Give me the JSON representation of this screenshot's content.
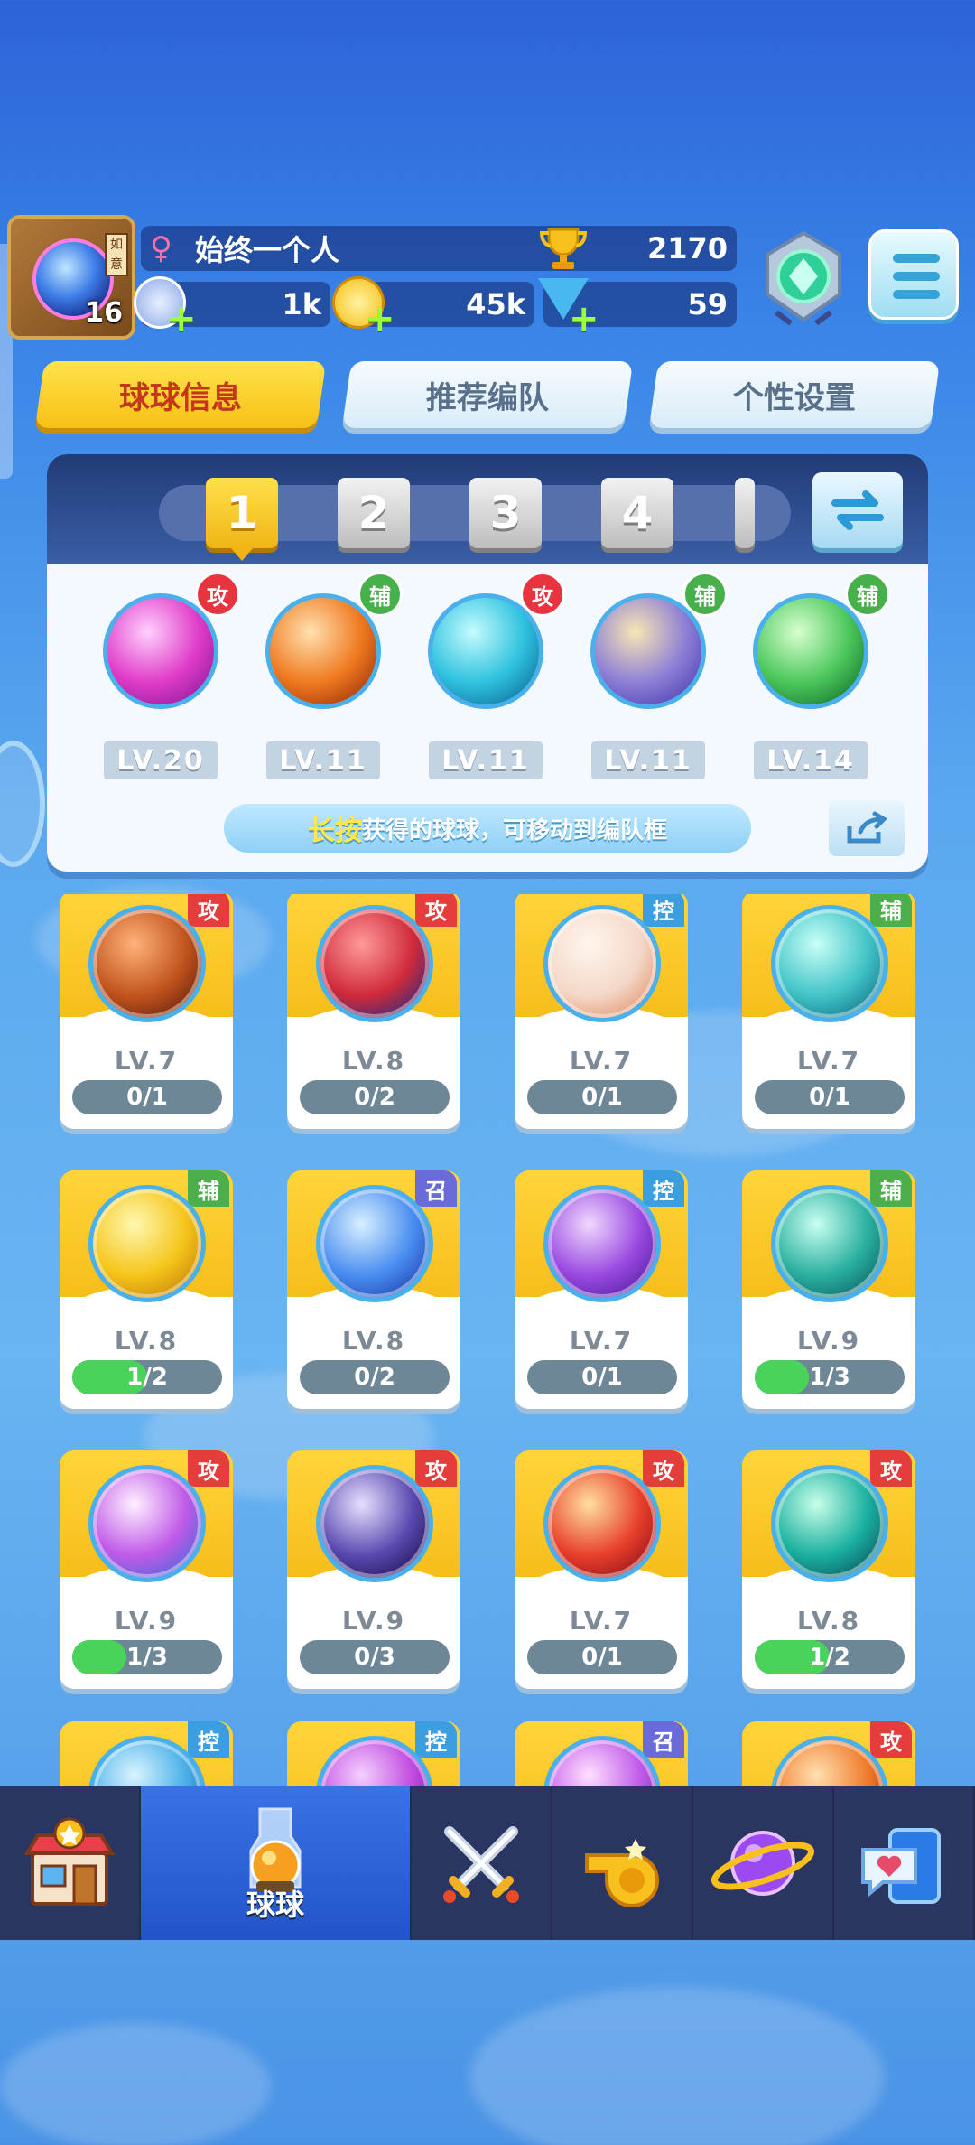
{
  "player": {
    "avatar_level": "16",
    "name": "始终一个人",
    "trophies": "2170",
    "energy": "1k",
    "coins": "45k",
    "gems": "59"
  },
  "tabs": [
    {
      "label": "球球信息",
      "active": true
    },
    {
      "label": "推荐编队",
      "active": false
    },
    {
      "label": "个性设置",
      "active": false
    }
  ],
  "team_slots": [
    "1",
    "2",
    "3",
    "4"
  ],
  "team": [
    {
      "type": "攻",
      "type_class": "atk",
      "level": "LV.20",
      "colors": [
        "#ffd0ff",
        "#e03cc8",
        "#8a1a9a"
      ]
    },
    {
      "type": "辅",
      "type_class": "sup",
      "level": "LV.11",
      "colors": [
        "#ffe1b0",
        "#f07a20",
        "#9a2e0a"
      ]
    },
    {
      "type": "攻",
      "type_class": "atk",
      "level": "LV.11",
      "colors": [
        "#c6fbff",
        "#2fc3de",
        "#0c6a9a"
      ]
    },
    {
      "type": "辅",
      "type_class": "sup",
      "level": "LV.11",
      "colors": [
        "#f9e6b4",
        "#8d7fd6",
        "#4b3db0"
      ]
    },
    {
      "type": "辅",
      "type_class": "sup",
      "level": "LV.14",
      "colors": [
        "#d8ffd0",
        "#4cc85c",
        "#136e2b"
      ]
    }
  ],
  "hint": {
    "highlight": "长按",
    "text": "获得的球球，可移动到编队框"
  },
  "balls": [
    {
      "type": "攻",
      "type_class": "atk",
      "level": "LV.7",
      "progress": "0/1",
      "fraction": 0,
      "colors": [
        "#ffb27a",
        "#c2541e",
        "#5a1a08"
      ]
    },
    {
      "type": "攻",
      "type_class": "atk",
      "level": "LV.8",
      "progress": "0/2",
      "fraction": 0,
      "colors": [
        "#ff9a9a",
        "#d02a3a",
        "#1a2a8a"
      ]
    },
    {
      "type": "控",
      "type_class": "ctl",
      "level": "LV.7",
      "progress": "0/1",
      "fraction": 0,
      "colors": [
        "#fff6ee",
        "#f4d8c8",
        "#e08a60"
      ]
    },
    {
      "type": "辅",
      "type_class": "sup",
      "level": "LV.7",
      "progress": "0/1",
      "fraction": 0,
      "colors": [
        "#c8fff6",
        "#42c4c8",
        "#0c6a80"
      ]
    },
    {
      "type": "辅",
      "type_class": "sup",
      "level": "LV.8",
      "progress": "1/2",
      "fraction": 0.5,
      "colors": [
        "#fff8b0",
        "#f5c51a",
        "#c07a08"
      ]
    },
    {
      "type": "召",
      "type_class": "sum",
      "level": "LV.8",
      "progress": "0/2",
      "fraction": 0,
      "colors": [
        "#d8f0ff",
        "#4a8ef0",
        "#1a3aa8"
      ]
    },
    {
      "type": "控",
      "type_class": "ctl",
      "level": "LV.7",
      "progress": "0/1",
      "fraction": 0,
      "colors": [
        "#f0d8ff",
        "#9a4ae0",
        "#4a1a9a"
      ]
    },
    {
      "type": "辅",
      "type_class": "sup",
      "level": "LV.9",
      "progress": "1/3",
      "fraction": 0.333,
      "colors": [
        "#c8fff0",
        "#2ab0a0",
        "#0a5a60"
      ]
    },
    {
      "type": "攻",
      "type_class": "atk",
      "level": "LV.9",
      "progress": "1/3",
      "fraction": 0.333,
      "colors": [
        "#fff0ff",
        "#c05ae8",
        "#3a6ad8"
      ]
    },
    {
      "type": "攻",
      "type_class": "atk",
      "level": "LV.9",
      "progress": "0/3",
      "fraction": 0,
      "colors": [
        "#e8e0ff",
        "#5a4ab0",
        "#1a0a4a"
      ]
    },
    {
      "type": "攻",
      "type_class": "atk",
      "level": "LV.7",
      "progress": "0/1",
      "fraction": 0,
      "colors": [
        "#ffe0a0",
        "#e8402a",
        "#8a0a1a"
      ]
    },
    {
      "type": "攻",
      "type_class": "atk",
      "level": "LV.8",
      "progress": "1/2",
      "fraction": 0.5,
      "colors": [
        "#c8ffe8",
        "#1ab0a0",
        "#0a4a5a"
      ]
    },
    {
      "type": "控",
      "type_class": "ctl",
      "level": "",
      "progress": "",
      "fraction": 0,
      "colors": [
        "#d8f4ff",
        "#4ab0e8",
        "#1a5aa8"
      ]
    },
    {
      "type": "控",
      "type_class": "ctl",
      "level": "",
      "progress": "",
      "fraction": 0,
      "colors": [
        "#f4d0ff",
        "#c04ae0",
        "#5a1a9a"
      ]
    },
    {
      "type": "召",
      "type_class": "sum",
      "level": "",
      "progress": "",
      "fraction": 0,
      "colors": [
        "#ffe0ff",
        "#c05ae8",
        "#5a2aa8"
      ]
    },
    {
      "type": "攻",
      "type_class": "atk",
      "level": "",
      "progress": "",
      "fraction": 0,
      "colors": [
        "#ffe0b0",
        "#f07a2a",
        "#a02a0a"
      ]
    }
  ],
  "nav": [
    {
      "icon": "shop-icon",
      "label": "",
      "active": false
    },
    {
      "icon": "ball-potion-icon",
      "label": "球球",
      "active": true
    },
    {
      "icon": "crossed-swords-icon",
      "label": "",
      "active": false
    },
    {
      "icon": "whistle-icon",
      "label": "",
      "active": false
    },
    {
      "icon": "planet-icon",
      "label": "",
      "active": false
    },
    {
      "icon": "chat-heart-icon",
      "label": "",
      "active": false
    }
  ]
}
